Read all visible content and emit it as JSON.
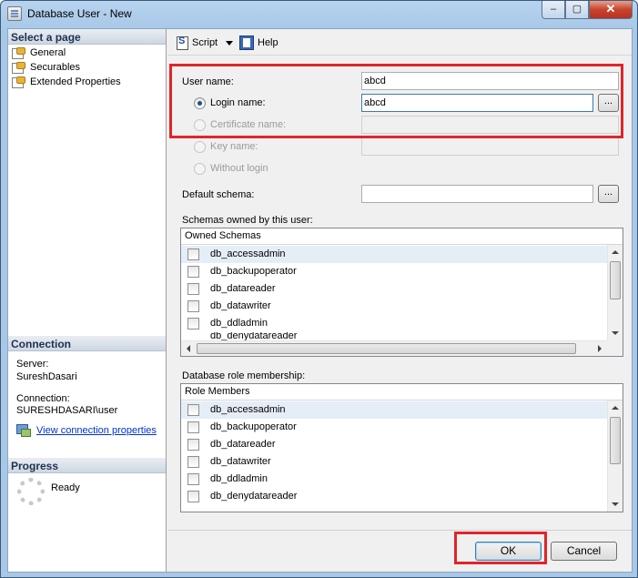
{
  "window": {
    "title": "Database User - New",
    "close_glyph": "✕",
    "minimize_glyph": "‒",
    "maximize_glyph": "▢"
  },
  "left_panel": {
    "select_page_header": "Select a page",
    "pages": [
      {
        "label": "General",
        "icon": "page-icon"
      },
      {
        "label": "Securables",
        "icon": "page-icon"
      },
      {
        "label": "Extended Properties",
        "icon": "page-icon"
      }
    ],
    "connection_header": "Connection",
    "server_label": "Server:",
    "server_value": "SureshDasari",
    "connection_label": "Connection:",
    "connection_value": "SURESHDASARI\\user",
    "view_connection_link": "View connection properties",
    "progress_header": "Progress",
    "progress_status": "Ready"
  },
  "toolbar": {
    "script_label": "Script",
    "help_label": "Help"
  },
  "form": {
    "user_name_label": "User name:",
    "user_name_value": "abcd",
    "login_name_label": "Login name:",
    "login_name_value": "abcd",
    "certificate_name_label": "Certificate name:",
    "certificate_name_value": "",
    "key_name_label": "Key name:",
    "key_name_value": "",
    "without_login_label": "Without login",
    "default_schema_label": "Default schema:",
    "default_schema_value": "",
    "browse_label": "...",
    "selected_option": "Login name"
  },
  "schemas_owned": {
    "label": "Schemas owned by this user:",
    "column_header": "Owned Schemas",
    "rows": [
      "db_accessadmin",
      "db_backupoperator",
      "db_datareader",
      "db_datawriter",
      "db_ddladmin",
      "db_denydatareader"
    ]
  },
  "role_membership": {
    "label": "Database role membership:",
    "column_header": "Role Members",
    "rows": [
      "db_accessadmin",
      "db_backupoperator",
      "db_datareader",
      "db_datawriter",
      "db_ddladmin",
      "db_denydatareader"
    ]
  },
  "footer": {
    "ok_label": "OK",
    "cancel_label": "Cancel"
  },
  "colors": {
    "highlight": "#e0252b",
    "link": "#0033cc",
    "window_frame": "#a9c8e8"
  }
}
